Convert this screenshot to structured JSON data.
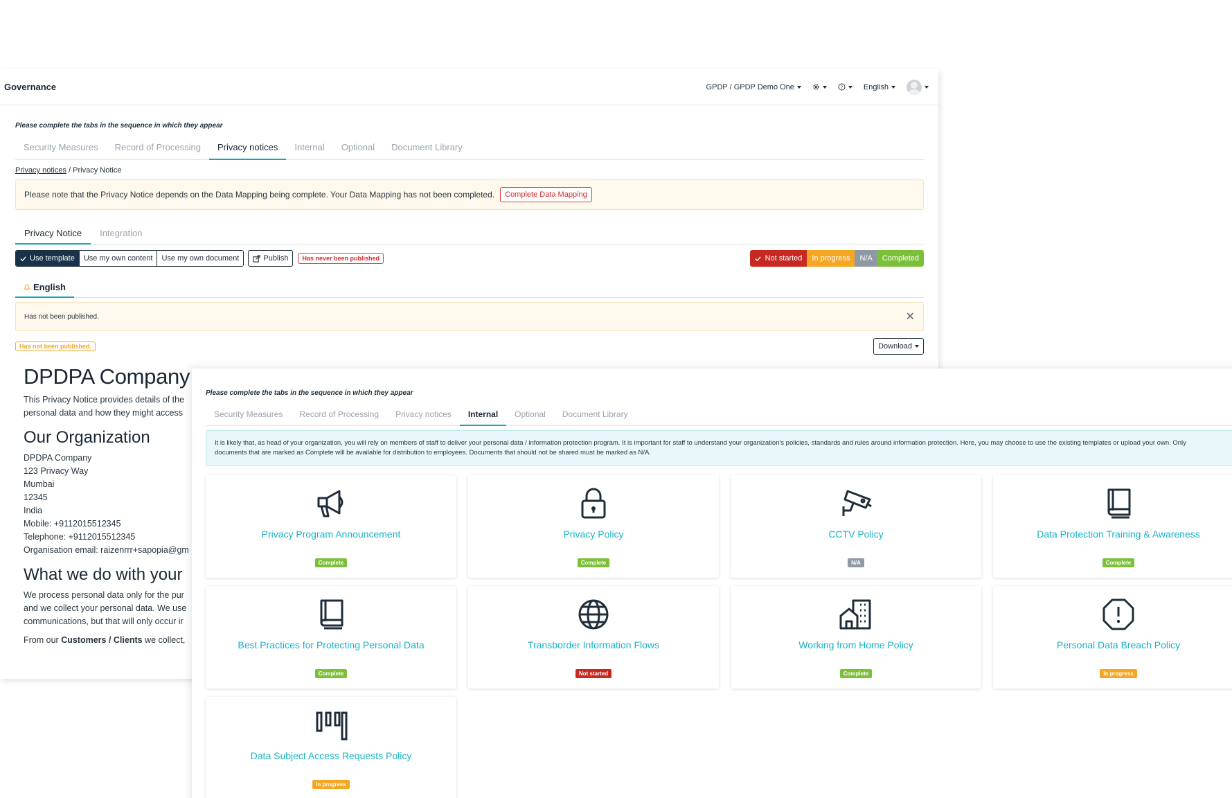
{
  "app": {
    "title": "Governance"
  },
  "topbar": {
    "org": "GPDP / GPDP Demo One",
    "language": "English"
  },
  "back": {
    "hint": "Please complete the tabs in the sequence in which they appear",
    "tabs": [
      "Security Measures",
      "Record of Processing",
      "Privacy notices",
      "Internal",
      "Optional",
      "Document Library"
    ],
    "breadcrumb": {
      "parent": "Privacy notices",
      "current": "Privacy Notice"
    },
    "alert_text": "Please note that the Privacy Notice depends on the Data Mapping being complete. Your Data Mapping has not been completed.",
    "alert_button": "Complete Data Mapping",
    "subtabs": [
      "Privacy Notice",
      "Integration"
    ],
    "toolbar": {
      "use_template": "Use template",
      "own_content": "Use my own content",
      "own_document": "Use my own document",
      "publish": "Publish",
      "never_published": "Has never been published"
    },
    "status": {
      "not_started": "Not started",
      "in_progress": "In progress",
      "na": "N/A",
      "completed": "Completed"
    },
    "language_tab": "English",
    "not_published_alert": "Has not been published.",
    "not_published_badge": "Has not been published.",
    "download": "Download",
    "doc": {
      "title": "DPDPA Company",
      "intro_1": "This Privacy Notice provides details of the",
      "intro_2": "personal data and how they might access",
      "org_heading": "Our Organization",
      "address": [
        "DPDPA Company",
        "123 Privacy Way",
        "Mumbai",
        "12345",
        "India",
        "Mobile: +9112015512345",
        "Telephone: +9112015512345",
        "Organisation email: raizenrrr+sapopia@gm"
      ],
      "what_heading": "What we do with your",
      "what_1": "We process personal data only for the pur",
      "what_2": "and we collect your personal data. We use",
      "what_3": "communications, but that will only occur ir",
      "from_prefix": "From our ",
      "from_bold": "Customers / Clients",
      "from_suffix": " we collect,"
    }
  },
  "front": {
    "hint": "Please complete the tabs in the sequence in which they appear",
    "tabs": [
      "Security Measures",
      "Record of Processing",
      "Privacy notices",
      "Internal",
      "Optional",
      "Document Library"
    ],
    "info": "It is likely that, as head of your organization, you will rely on members of staff to deliver your personal data / information protection program. It is important for staff to understand your organization's policies, standards and rules around information protection. Here, you may choose to use the existing templates or upload your own. Only documents that are marked as Complete will be available for distribution to employees. Documents that should not be shared must be marked as N/A.",
    "cards": [
      {
        "title": "Privacy Program Announcement",
        "status": "Complete",
        "icon": "megaphone-icon"
      },
      {
        "title": "Privacy Policy",
        "status": "Complete",
        "icon": "lock-icon"
      },
      {
        "title": "CCTV Policy",
        "status": "N/A",
        "icon": "cctv-camera-icon"
      },
      {
        "title": "Data Protection Training & Awareness",
        "status": "Complete",
        "icon": "book-icon"
      },
      {
        "title": "Best Practices for Protecting Personal Data",
        "status": "Complete",
        "icon": "book-icon"
      },
      {
        "title": "Transborder Information Flows",
        "status": "Not started",
        "icon": "globe-icon"
      },
      {
        "title": "Working from Home Policy",
        "status": "Complete",
        "icon": "home-office-icon"
      },
      {
        "title": "Personal Data Breach Policy",
        "status": "In progress",
        "icon": "alert-octagon-icon"
      },
      {
        "title": "Data Subject Access Requests Policy",
        "status": "In progress",
        "icon": "bars-icon"
      }
    ]
  },
  "colors": {
    "accent": "#19a7b8",
    "complete": "#7cc03a",
    "in_progress": "#f5a623",
    "not_started": "#c7281f",
    "na": "#8e99a5"
  }
}
